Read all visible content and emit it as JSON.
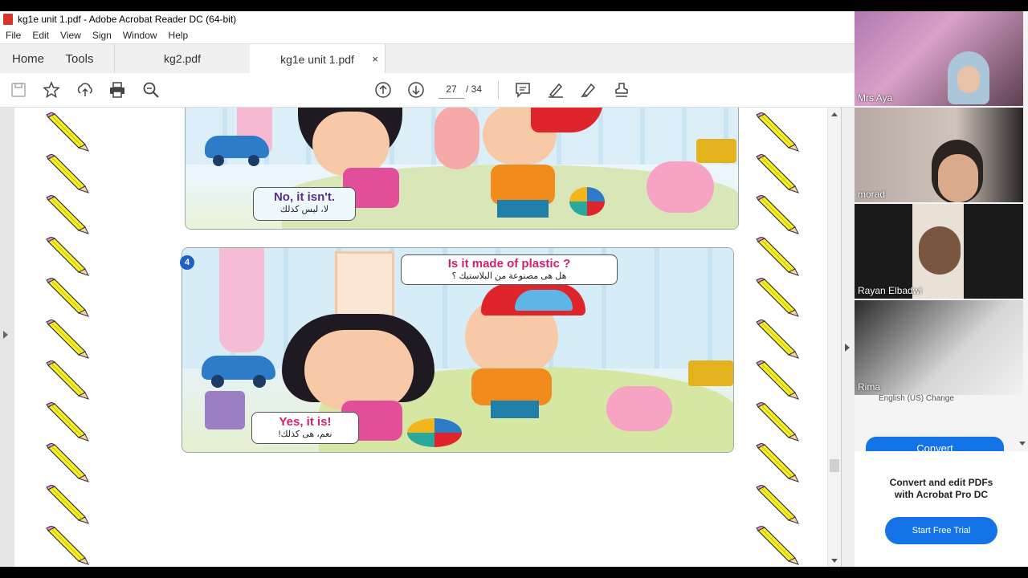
{
  "window": {
    "title": "kg1e unit 1.pdf - Adobe Acrobat Reader DC (64-bit)"
  },
  "menu": [
    "File",
    "Edit",
    "View",
    "Sign",
    "Window",
    "Help"
  ],
  "tabs": {
    "home": "Home",
    "tools": "Tools",
    "doc1": "kg2.pdf",
    "doc2": "kg1e unit 1.pdf",
    "close": "×"
  },
  "toolbar": {
    "page_current": "27",
    "page_total": "/ 34"
  },
  "icons": [
    "save-icon",
    "star-icon",
    "upload-icon",
    "print-icon",
    "zoom-icon",
    "page-up-icon",
    "page-down-icon",
    "comment-icon",
    "highlight-icon",
    "sign-icon",
    "stamp-icon"
  ],
  "document": {
    "bubble1_en": "No, it isn't.",
    "bubble1_ar": "لا، ليس كذلك",
    "panel2_number": "4",
    "bubble2_en": "Is it made of plastic ?",
    "bubble2_ar": "هل هى مصنوعة من البلاستيك ؟",
    "bubble3_en": "Yes, it is!",
    "bubble3_ar": "نعم، هى كذلك!"
  },
  "participants": [
    {
      "name": "Mrs Aya"
    },
    {
      "name": "morad"
    },
    {
      "name": "Rayan Elbadwi"
    },
    {
      "name": "Rima"
    }
  ],
  "promo": {
    "cutoff_text": "English (US) Change",
    "convert_label": "Convert",
    "title_line1": "Convert and edit PDFs",
    "title_line2": "with Acrobat Pro DC",
    "trial_label": "Start Free Trial"
  },
  "colors": {
    "accent_blue": "#1473e6",
    "bubble_pink": "#d0206e",
    "pencil_yellow": "#f7ef2a"
  }
}
